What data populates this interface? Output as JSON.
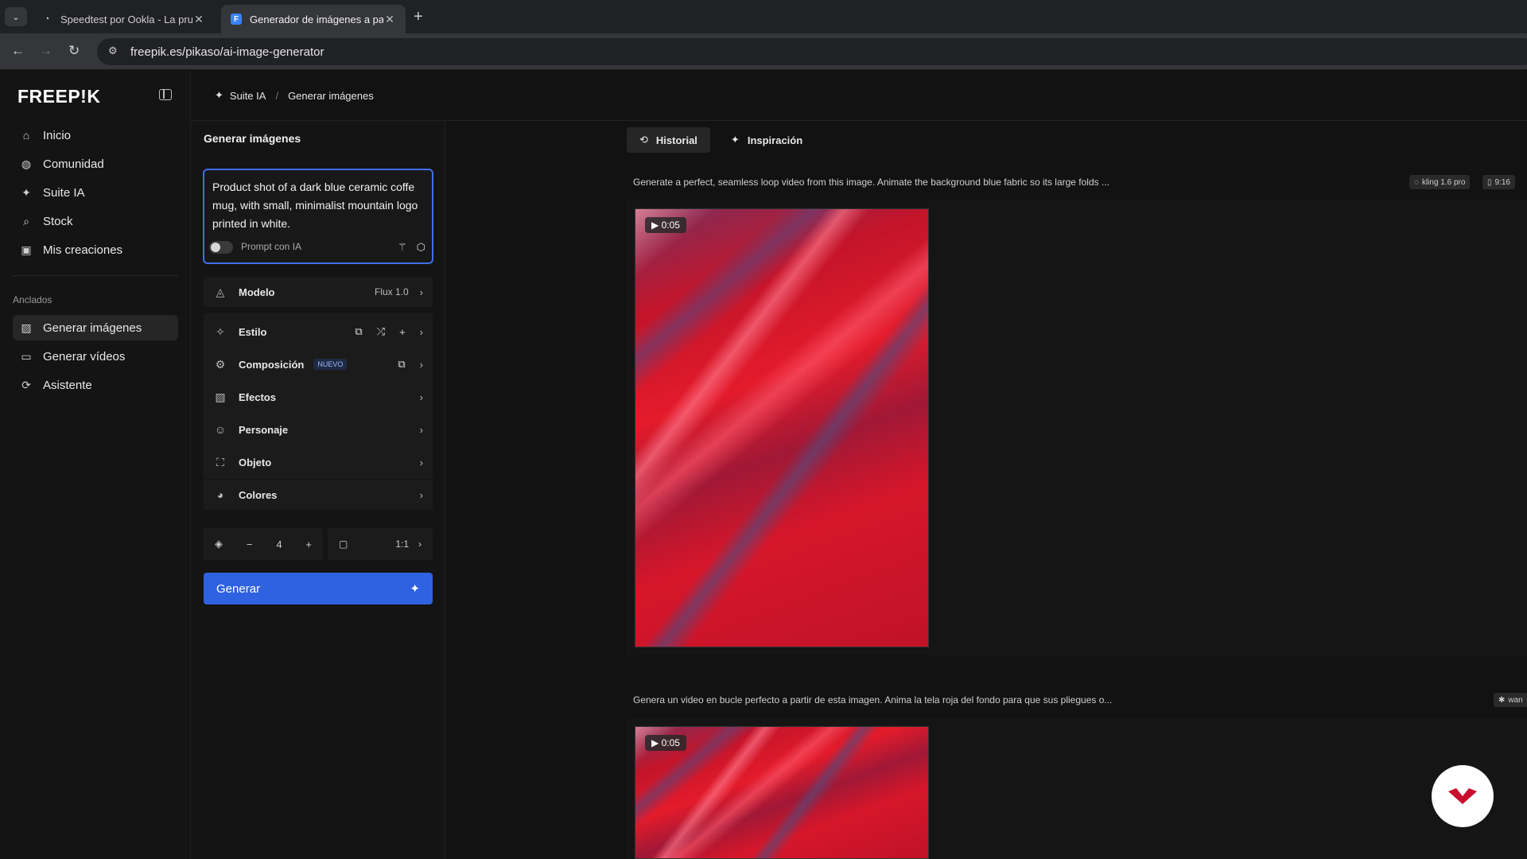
{
  "browser": {
    "tabs": [
      {
        "title": "Speedtest por Ookla - La prueb",
        "icon": "speedtest-icon"
      },
      {
        "title": "Generador de imágenes a partir",
        "icon": "freepik-icon"
      }
    ],
    "url": "freepik.es/pikaso/ai-image-generator"
  },
  "sidebar": {
    "logo": "FREEP!K",
    "items": [
      {
        "label": "Inicio",
        "icon": "home-icon"
      },
      {
        "label": "Comunidad",
        "icon": "globe-icon"
      },
      {
        "label": "Suite IA",
        "icon": "sparkle-icon"
      },
      {
        "label": "Stock",
        "icon": "search-icon"
      },
      {
        "label": "Mis creaciones",
        "icon": "gallery-icon"
      }
    ],
    "pinned_label": "Anclados",
    "pinned": [
      {
        "label": "Generar imágenes",
        "icon": "image-icon"
      },
      {
        "label": "Generar vídeos",
        "icon": "video-icon"
      },
      {
        "label": "Asistente",
        "icon": "assistant-icon"
      }
    ]
  },
  "breadcrumb": {
    "root": "Suite IA",
    "separator": "/",
    "current": "Generar imágenes"
  },
  "panel": {
    "title": "Generar imágenes",
    "prompt": "Product shot of a dark blue ceramic coffe mug, with small, minimalist mountain logo printed in white.",
    "prompt_ai_label": "Prompt con IA",
    "options": {
      "modelo": {
        "label": "Modelo",
        "value": "Flux 1.0"
      },
      "estilo": {
        "label": "Estilo"
      },
      "composicion": {
        "label": "Composición",
        "badge": "NUEVO"
      },
      "efectos": {
        "label": "Efectos"
      },
      "personaje": {
        "label": "Personaje"
      },
      "objeto": {
        "label": "Objeto"
      },
      "colores": {
        "label": "Colores"
      }
    },
    "quantity": "4",
    "ratio": "1:1",
    "generate_label": "Generar"
  },
  "main": {
    "tabs": [
      {
        "label": "Historial",
        "icon": "history-icon"
      },
      {
        "label": "Inspiración",
        "icon": "sparkle-icon"
      }
    ],
    "generations": [
      {
        "prompt": "Generate a perfect, seamless loop video from this image. Animate the background blue fabric so its large folds ...",
        "model": "kling 1.6 pro",
        "aspect": "9:16",
        "duration": "0:05"
      },
      {
        "prompt": "Genera un video en bucle perfecto a partir de esta imagen. Anima la tela roja del fondo para que sus pliegues o...",
        "model": "wan",
        "duration": "0:05"
      }
    ]
  }
}
